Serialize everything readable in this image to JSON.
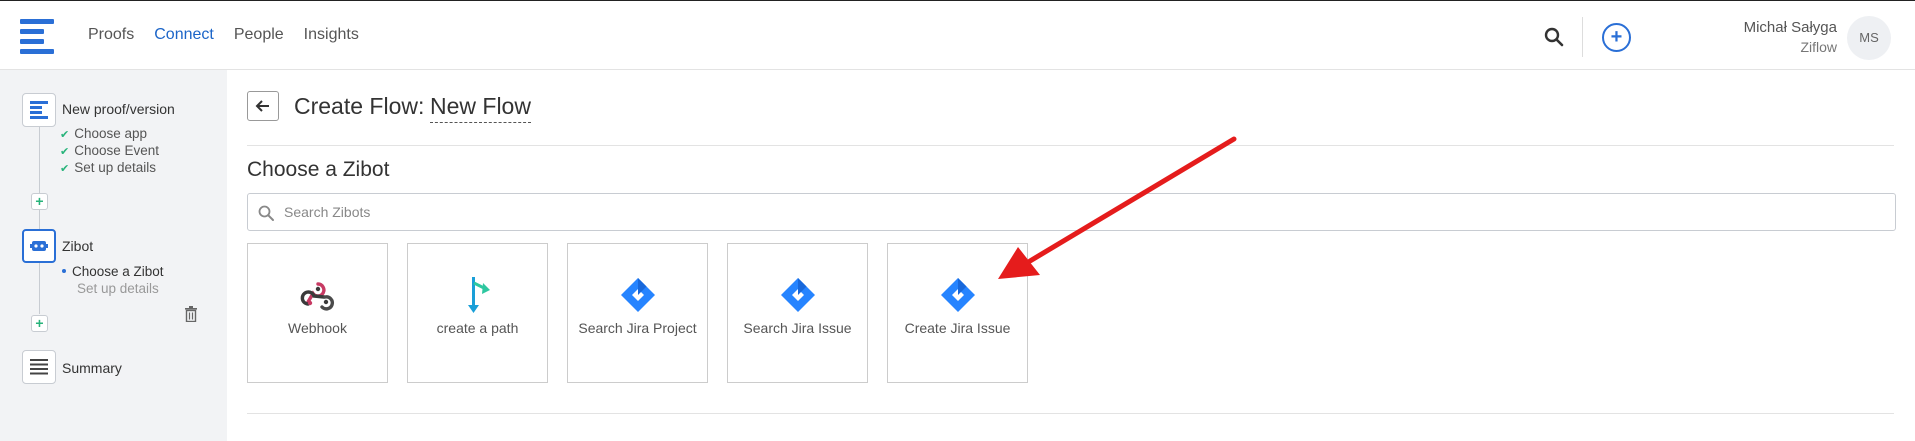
{
  "nav": {
    "items": [
      "Proofs",
      "Connect",
      "People",
      "Insights"
    ],
    "active": "Connect"
  },
  "user": {
    "name": "Michał Sałyga",
    "org": "Ziflow",
    "initials": "MS"
  },
  "sidebar": {
    "step1": {
      "title": "New proof/version",
      "subs": [
        "Choose app",
        "Choose Event",
        "Set up details"
      ]
    },
    "step2": {
      "title": "Zibot",
      "subs": [
        "Choose a Zibot",
        "Set up details"
      ]
    },
    "step3": {
      "title": "Summary"
    }
  },
  "header": {
    "prefix": "Create Flow:",
    "flow_name": "New Flow"
  },
  "section": {
    "title": "Choose a Zibot"
  },
  "search": {
    "placeholder": "Search Zibots",
    "value": ""
  },
  "cards": [
    {
      "label": "Webhook",
      "icon": "webhook-icon"
    },
    {
      "label": "create a path",
      "icon": "path-icon"
    },
    {
      "label": "Search Jira Project",
      "icon": "jira-icon"
    },
    {
      "label": "Search Jira Issue",
      "icon": "jira-icon"
    },
    {
      "label": "Create Jira Issue",
      "icon": "jira-icon"
    }
  ],
  "colors": {
    "accent": "#2a6fd6",
    "check": "#27b37a",
    "annotation_arrow": "#e51c1c"
  }
}
